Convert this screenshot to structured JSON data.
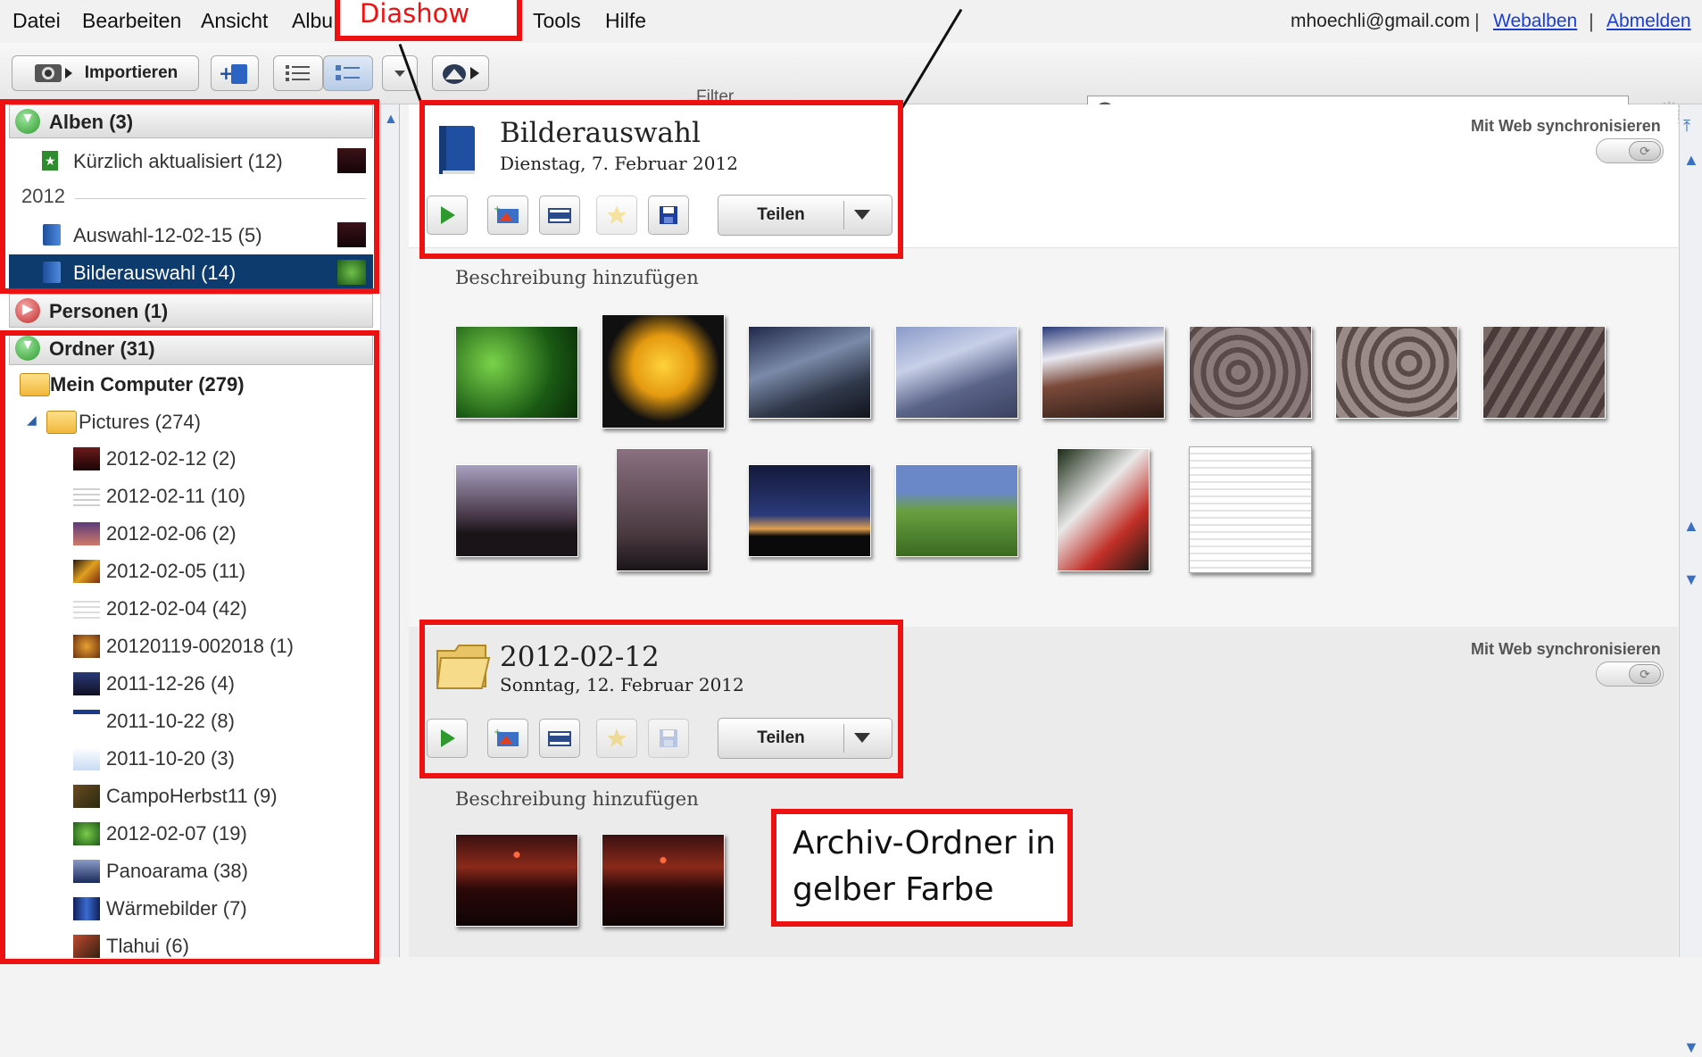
{
  "menubar": {
    "items": [
      "Datei",
      "Bearbeiten",
      "Ansicht",
      "Albu",
      "Tools",
      "Hilfe"
    ],
    "email": "mhoechli@gmail.com",
    "sep": "|",
    "links": [
      "Webalben",
      "Abmelden"
    ]
  },
  "toolbar": {
    "import_label": "Importieren",
    "filter_label": "Filter",
    "search_placeholder": ""
  },
  "sidebar": {
    "albums_header": "Alben (3)",
    "albums": [
      {
        "label": "Kürzlich aktualisiert (12)"
      },
      {
        "label": "Auswahl-12-02-15 (5)"
      },
      {
        "label": "Bilderauswahl (14)"
      }
    ],
    "year": "2012",
    "people_header": "Personen (1)",
    "folders_header": "Ordner (31)",
    "my_computer": "Mein Computer (279)",
    "pictures": "Pictures (274)",
    "folders": [
      "2012-02-12 (2)",
      "2012-02-11 (10)",
      "2012-02-06 (2)",
      "2012-02-05 (11)",
      "2012-02-04 (42)",
      "20120119-002018 (1)",
      "2011-12-26 (4)",
      "2011-10-22 (8)",
      "2011-10-20 (3)",
      "CampoHerbst11 (9)",
      "2012-02-07 (19)",
      "Panoarama (38)",
      "Wärmebilder (7)",
      "Tlahui (6)"
    ]
  },
  "main": {
    "album1": {
      "title": "Bilderauswahl",
      "date": "Dienstag, 7. Februar 2012",
      "share": "Teilen",
      "sync": "Mit Web synchronisieren",
      "description": "Beschreibung hinzufügen"
    },
    "album2": {
      "title": "2012-02-12",
      "date": "Sonntag, 12. Februar 2012",
      "share": "Teilen",
      "sync": "Mit Web synchronisieren",
      "description": "Beschreibung hinzufügen"
    }
  },
  "annotations": {
    "diashow": "Diashow",
    "archive_line1": "Archiv-Ordner in",
    "archive_line2": "gelber Farbe"
  },
  "colors": {
    "annotation_red": "#ee1111",
    "selection_blue": "#0e3b6e",
    "link_blue": "#1a3fd0"
  }
}
